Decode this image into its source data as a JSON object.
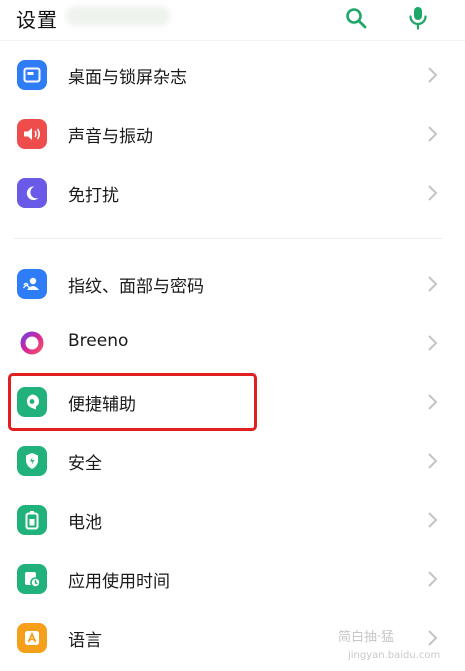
{
  "header": {
    "title": "设置",
    "search_icon": "search-icon",
    "mic_icon": "mic-icon",
    "accent_color": "#1fa76a"
  },
  "settings": {
    "group1": [
      {
        "label": "桌面与锁屏杂志",
        "icon": "wallpaper-icon",
        "color": "#2f7df6"
      },
      {
        "label": "声音与振动",
        "icon": "speaker-icon",
        "color": "#ef4c4c"
      },
      {
        "label": "免打扰",
        "icon": "moon-icon",
        "color": "#6a5ae8"
      }
    ],
    "group2": [
      {
        "label": "指纹、面部与密码",
        "icon": "fingerprint-face-icon",
        "color": "#2f7df6"
      },
      {
        "label": "Breeno",
        "icon": "breeno-icon",
        "color": "#c027a6"
      },
      {
        "label": "便捷辅助",
        "icon": "assist-icon",
        "color": "#20b27a",
        "highlighted": true
      },
      {
        "label": "安全",
        "icon": "shield-icon",
        "color": "#20b27a"
      },
      {
        "label": "电池",
        "icon": "battery-icon",
        "color": "#20b27a"
      },
      {
        "label": "应用使用时间",
        "icon": "app-usage-icon",
        "color": "#20b27a"
      },
      {
        "label": "语言",
        "icon": "language-icon",
        "color": "#f59f1a"
      }
    ]
  },
  "highlight_color": "#e02020",
  "watermark": {
    "text_line1": "简白抽·猛",
    "text_line2": "jingyan.baidu.com"
  }
}
